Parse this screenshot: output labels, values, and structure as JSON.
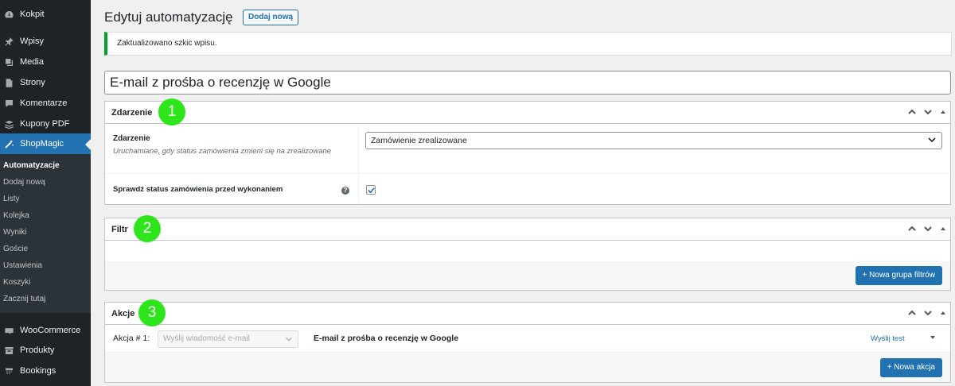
{
  "sidebar": {
    "items": [
      {
        "label": "Kokpit",
        "icon": "dashboard-icon"
      },
      {
        "label": "Wpisy",
        "icon": "pin-icon"
      },
      {
        "label": "Media",
        "icon": "media-icon"
      },
      {
        "label": "Strony",
        "icon": "page-icon"
      },
      {
        "label": "Komentarze",
        "icon": "comment-icon"
      },
      {
        "label": "Kupony PDF",
        "icon": "stack-icon"
      },
      {
        "label": "ShopMagic",
        "icon": "magic-wand-icon"
      },
      {
        "label": "WooCommerce",
        "icon": "woo-icon"
      },
      {
        "label": "Produkty",
        "icon": "archive-icon"
      },
      {
        "label": "Bookings",
        "icon": "calendar-icon"
      }
    ],
    "submenu": [
      "Automatyzacje",
      "Dodaj nową",
      "Listy",
      "Kolejka",
      "Wyniki",
      "Goście",
      "Ustawienia",
      "Koszyki",
      "Zacznij tutaj"
    ]
  },
  "header": {
    "title": "Edytuj automatyzację",
    "add_new": "Dodaj nową"
  },
  "notice": "Zaktualizowano szkic wpisu.",
  "post_title": "E-mail z prośba o recenzję w Google",
  "event_box": {
    "title": "Zdarzenie",
    "badge": "1",
    "field_label": "Zdarzenie",
    "field_desc": "Uruchamiane, gdy status zamówienia zmieni się na zrealizowane",
    "selected": "Zamówienie zrealizowane",
    "check_label": "Sprawdź status zamówienia przed wykonaniem",
    "help": "?",
    "checked": true
  },
  "filter_box": {
    "title": "Filtr",
    "badge": "2",
    "button": "+ Nowa grupa filtrów"
  },
  "actions_box": {
    "title": "Akcje",
    "badge": "3",
    "action_label": "Akcja # 1:",
    "action_select": "Wyślij wiadomość e-mail",
    "action_title": "E-mail z prośba o recenzję w Google",
    "send_test": "Wyślij test",
    "button": "+ Nowa akcja"
  },
  "colors": {
    "sidebar_bg": "#1d2327",
    "active": "#2271b1",
    "badge": "#2ee51b",
    "notice_border": "#00a32a"
  }
}
